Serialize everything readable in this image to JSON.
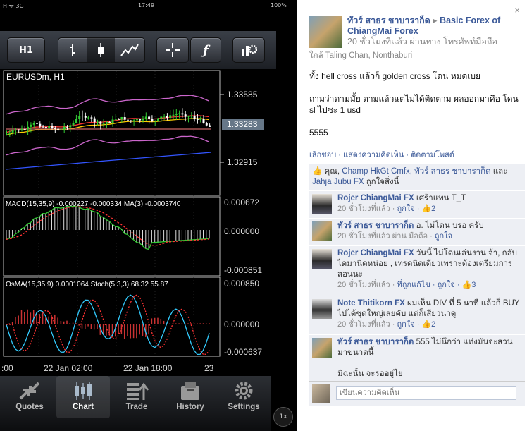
{
  "statusbar": {
    "left": "H ᯤ 3G",
    "time": "17:49",
    "battery": "100%"
  },
  "toolbar": {
    "timeframe": "H1",
    "tools": [
      "bar-chart-icon",
      "candlestick-icon",
      "line-chart-icon",
      "crosshair-icon",
      "function-icon",
      "settings-tools-icon"
    ]
  },
  "chart": {
    "symbol_label": "EURUSDm, H1",
    "price_labels": [
      "1.33585",
      "1.33283",
      "1.32915"
    ],
    "macd_label": "MACD(15,35,9) -0.000227 -0.000334 MA(3) -0.0003740",
    "macd_levels": [
      "0.000672",
      "0.000000",
      "-0.000851"
    ],
    "osma_label": "OsMA(15,35,9) 0.0001064 Stoch(5,3,3) 68.32 55.87",
    "osma_levels": [
      "0.000850",
      "0.000000",
      "-0.000637"
    ],
    "time_labels": [
      ":00",
      "22 Jan 02:00",
      "22 Jan 18:00",
      "23"
    ],
    "colors": {
      "bull": "#33cc33",
      "bear": "#ffffff",
      "envelope": "#cc66cc",
      "ma_fast": "#ff3333",
      "ma_slow": "#ffcc00",
      "ma_trend": "#3355ff",
      "macd_line": "#33cc33",
      "signal": "#ff3333",
      "stoch": "#33ccff",
      "osma_bar": "#cc3333"
    }
  },
  "tabs": [
    {
      "label": "Quotes",
      "icon": "quotes-icon"
    },
    {
      "label": "Chart",
      "icon": "chart-icon"
    },
    {
      "label": "Trade",
      "icon": "trade-icon"
    },
    {
      "label": "History",
      "icon": "history-icon"
    },
    {
      "label": "Settings",
      "icon": "settings-icon"
    }
  ],
  "zoom": "1x",
  "fb": {
    "close": "×",
    "author": "ทัวร์ สาธร ชาบาราก็ด",
    "arrow": "▸",
    "group": "Basic Forex of ChiangMai Forex",
    "time_via": "20 ชั่วโมงที่แล้ว ผ่านทาง โทรศัพท์มือถือ",
    "location": "ใกล้ Taling Chan, Nonthaburi",
    "post_lines": [
      "ทั้ง hell cross แล้วก็ golden cross โดน หมดเบย",
      "ถามว่าตามมั้ย ตามแล้วแต่ไม่ได้ติดตาม ผลออกมาคือ โดน sl ไปซะ 1 usd",
      "5555"
    ],
    "actions": "เลิกชอบ · แสดงความคิดเห็น · ติดตามโพสต์",
    "likes_text_pre": "คุณ,",
    "likes_names": "Champ HkGt Cmfx, ทัวร์ สาธร ชาบาราก็ด",
    "likes_and": "และ",
    "likes_last": "Jahja Jubu FX",
    "likes_post": "ถูกใจสิ่งนี้",
    "comments": [
      {
        "name": "Rojer ChiangMai FX",
        "text": "เศร้าแทน T_T",
        "meta": "20 ชั่วโมงที่แล้ว · ",
        "like": "ถูกใจ",
        "count": " · 👍2"
      },
      {
        "name": "ทัวร์ สาธร ชาบาราก็ด",
        "text": "อ. ไม่โดน บรอ ครับ",
        "meta": "20 ชั่วโมงที่แล้ว ผ่าน มือถือ · ",
        "like": "ถูกใจ",
        "count": ""
      },
      {
        "name": "Rojer ChiangMai FX",
        "text": "วันนี้ ไม่โดนเล่นงาน จ้า, กลับไดมานิดหน่อย , เทรดนิดเดียวเพราะต้องเตรียมการสอนนะ",
        "meta": "20 ชั่วโมงที่แล้ว · ",
        "like": "ที่ถูกแก้ไข · ถูกใจ",
        "count": " · 👍3"
      },
      {
        "name": "Note Thitikorn FX",
        "text": "ผมเห็น DIV ที่ 5 นาที แล้วก็ BUY ไปได้ชุดใหญ่เลยคับ แต่ก็เสียวน่าดู",
        "meta": "20 ชั่วโมงที่แล้ว · ",
        "like": "ถูกใจ",
        "count": " · 👍2"
      },
      {
        "name": "ทัวร์ สาธร ชาบาราก็ด",
        "text": "555 ไม่นึกว่า แท่งมันจะสวนมาขนาดนี้",
        "text2": "มิฉะนั้น จะรออยู่ไย",
        "meta": "",
        "like": "",
        "count": ""
      }
    ],
    "write_placeholder": "เขียนความคิดเห็น"
  }
}
